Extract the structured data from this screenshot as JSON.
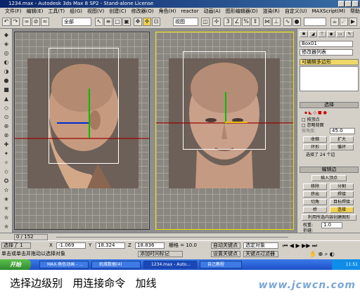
{
  "window": {
    "title": "1234.max - Autodesk 3ds Max 8 SP2 - Stand-alone License"
  },
  "menu": [
    "文件(F)",
    "编辑(E)",
    "工具(T)",
    "组(G)",
    "视图(V)",
    "创建(C)",
    "修改器(O)",
    "角色(H)",
    "reactor",
    "动画(A)",
    "图形编辑器(D)",
    "渲染(R)",
    "自定义(U)",
    "MAXScript(M)",
    "帮助(H)"
  ],
  "toolbar": {
    "selection_filter": "全部",
    "ref_coord": "视图"
  },
  "viewports": {
    "left_label": "",
    "right_label": ""
  },
  "command_panel": {
    "object_name": "Box01",
    "modifier_list": "修改器列表",
    "stack_item": "可编辑多边形",
    "rollout_selection": "选择",
    "by_vertex": "按顶点",
    "ignore_backfacing": "忽略背面",
    "angle_label": "按角度:",
    "angle_value": "45.0",
    "shrink": "收缩",
    "grow": "扩大",
    "ring": "环形",
    "loop": "循环",
    "selected_status": "选择了 24 个边",
    "rollout_edit_edges": "编辑边",
    "insert_vertex": "插入顶点",
    "remove": "移除",
    "split": "分割",
    "extrude": "挤出",
    "weld": "焊接",
    "chamfer": "切角",
    "target_weld": "目标焊接",
    "bridge": "桥",
    "connect": "连接",
    "create_shape": "利用所选内容创建图形",
    "weight_label": "权重:",
    "weight_value": "1.0",
    "crease_label": "折缝:",
    "crease_value": "0.0"
  },
  "timeline": {
    "frame": "0 / 152"
  },
  "status": {
    "selected": "选择了 1",
    "x_value": "-1.069",
    "y_value": "18.324",
    "z_value": "18.836",
    "grid_label": "栅格 = 10.0",
    "prompt": "单击或单击并拖动以选择对象",
    "add_time_tag": "添加时间标记",
    "auto_key": "自动关键点",
    "set_key": "设置关键点",
    "selected_objects": "选定对象",
    "key_filters": "关键点过滤器"
  },
  "taskbar": {
    "start": "开始",
    "tasks": [
      "MAX-角色动画 - ...",
      "机缘数据(4)",
      "1234.max - Auto...",
      "自己教程"
    ],
    "clock": "11:51"
  },
  "caption": "选择边级别   用连接命令   加线",
  "watermark": "www.jcwcn.com"
}
